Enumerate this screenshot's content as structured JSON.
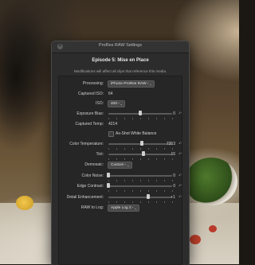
{
  "window": {
    "title": "ProRes RAW Settings"
  },
  "header": {
    "title": "Episode 5: Mise en Place",
    "subtitle": "Modifications will affect all clips that reference this media."
  },
  "rows": {
    "processing": {
      "label": "Processing:",
      "value": "iPhone ProRes RAW"
    },
    "captured_iso": {
      "label": "Captured ISO:",
      "value": "64"
    },
    "iso": {
      "label": "ISO:",
      "value": "400"
    },
    "exposure_bias": {
      "label": "Exposure Bias:",
      "value": "0",
      "level": 0.5
    },
    "captured_temp": {
      "label": "Captured Temp:",
      "value": "4214"
    },
    "as_shot_wb": {
      "label": "As-Shot White Balance",
      "checked": false
    },
    "color_temperature": {
      "label": "Color Temperature:",
      "value": "7253",
      "level": 0.53
    },
    "tint": {
      "label": "Tint:",
      "value": "16",
      "level": 0.55
    },
    "demosaic": {
      "label": "Demosaic:",
      "value": "Custom"
    },
    "color_noise": {
      "label": "Color Noise:",
      "value": "0",
      "level": 0.0
    },
    "edge_contrast": {
      "label": "Edge Contrast:",
      "value": "0",
      "level": 0.0
    },
    "detail_enhancement": {
      "label": "Detail Enhancement:",
      "value": "+1",
      "level": 0.62
    },
    "raw_to_log": {
      "label": "RAW to Log:",
      "value": "Apple Log 2"
    }
  },
  "icons": {
    "reset": "reset-arrow-icon",
    "close": "close-icon",
    "popup": "chevron-updown-icon"
  }
}
